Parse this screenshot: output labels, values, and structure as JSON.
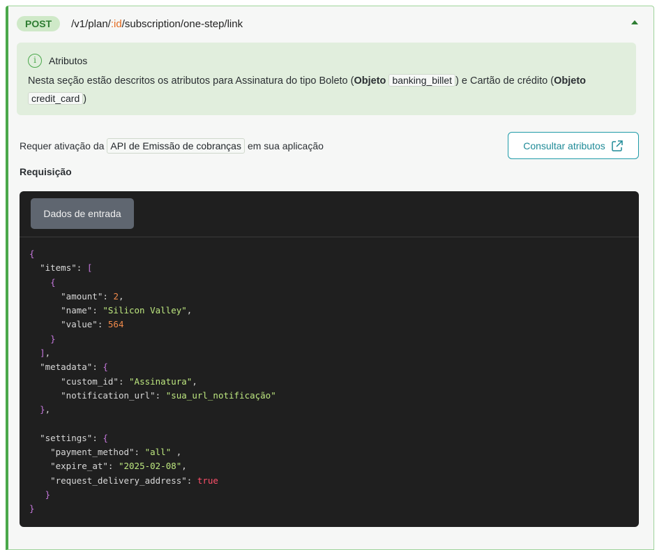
{
  "endpoint": {
    "method": "POST",
    "path_prefix": "/v1/plan/",
    "path_param": ":id",
    "path_suffix": "/subscription/one-step/link"
  },
  "info": {
    "title": "Atributos",
    "text_1": "Nesta seção estão descritos os atributos para Assinatura do tipo Boleto (",
    "bold_1": "Objeto",
    "chip_1": "banking_billet",
    "text_2": ") e Cartão de crédito (",
    "bold_2": "Objeto",
    "chip_2": "credit_card",
    "text_3": ")"
  },
  "requirement": {
    "prefix": "Requer ativação da",
    "chip": "API de Emissão de cobranças",
    "suffix": "em sua aplicação"
  },
  "consult_button": {
    "label": "Consultar atributos"
  },
  "request_label": "Requisição",
  "code_panel": {
    "tab_label": "Dados de entrada",
    "code": {
      "items": [
        {
          "amount": 2,
          "name": "Silicon Valley",
          "value": 564
        }
      ],
      "metadata": {
        "custom_id": "Assinatura",
        "notification_url": "sua_url_notificação"
      },
      "settings": {
        "payment_method": "all",
        "expire_at": "2025-02-08",
        "request_delivery_address": true
      }
    }
  },
  "colors": {
    "accent_green": "#4aa84a",
    "badge_bg": "#cfe9c8",
    "info_bg": "#e1eedd",
    "button_teal": "#1f9aa8",
    "code_bg": "#1f1f1f"
  },
  "icons": {
    "info": "info-icon",
    "external_link": "external-link-icon",
    "collapse": "chevron-up-icon"
  }
}
